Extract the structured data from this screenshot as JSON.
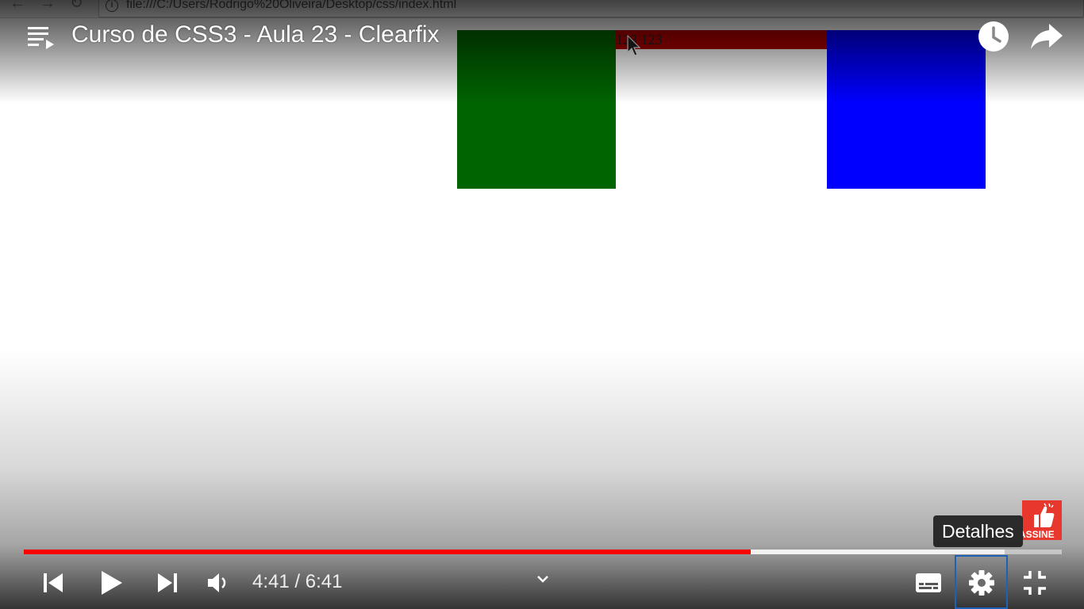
{
  "browser": {
    "url": "file:///C:/Users/Rodrigo%20Oliveira/Desktop/css/index.html"
  },
  "page_content": {
    "red_box_text": "123 123",
    "colors": {
      "green_box": "#006400",
      "blue_box": "#0000ff",
      "red_box": "#b00000"
    }
  },
  "player": {
    "title": "Curso de CSS3 - Aula 23 - Clearfix",
    "tooltip": "Detalhes",
    "subscribe_badge": "ASSINE",
    "time": {
      "current": "4:41",
      "separator": "/",
      "duration": "6:41",
      "display": "4:41 / 6:41"
    },
    "progress": {
      "played_fraction": 0.7,
      "buffered_fraction": 0.945
    },
    "colors": {
      "progress_played": "#ff0000",
      "settings_focus_ring": "#1c62b9"
    },
    "icons": {
      "playlist": "playlist-icon",
      "watch_later": "clock-icon",
      "share": "share-icon",
      "previous": "skip-previous-icon",
      "play": "play-icon",
      "next": "skip-next-icon",
      "volume": "volume-icon",
      "chapter_expand": "chevron-down-icon",
      "subtitles": "subtitles-icon",
      "settings": "gear-icon",
      "exit_fullscreen": "exit-fullscreen-icon",
      "subscribe": "thumbs-up-icon"
    }
  }
}
